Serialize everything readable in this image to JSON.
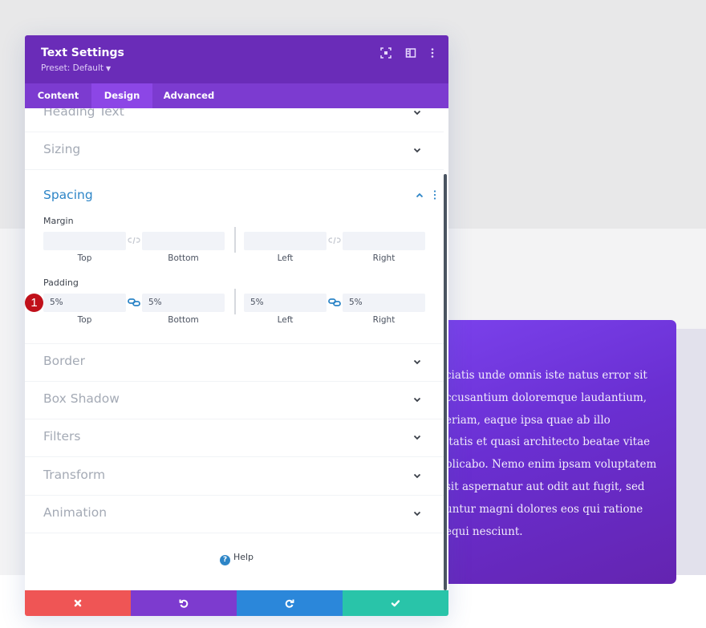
{
  "modal": {
    "title": "Text Settings",
    "preset_label": "Preset: Default",
    "header_icons": [
      "focus-icon",
      "split-view-icon",
      "more-options-icon"
    ],
    "tabs": [
      {
        "label": "Content",
        "active": false
      },
      {
        "label": "Design",
        "active": true
      },
      {
        "label": "Advanced",
        "active": false
      }
    ],
    "sections_above": [
      {
        "label": "Heading Text"
      },
      {
        "label": "Sizing"
      }
    ],
    "spacing": {
      "title": "Spacing",
      "margin": {
        "label": "Margin",
        "top": {
          "value": "",
          "label": "Top"
        },
        "bottom": {
          "value": "",
          "label": "Bottom"
        },
        "left": {
          "value": "",
          "label": "Left"
        },
        "right": {
          "value": "",
          "label": "Right"
        },
        "linked": false
      },
      "padding": {
        "label": "Padding",
        "top": {
          "value": "5%",
          "label": "Top"
        },
        "bottom": {
          "value": "5%",
          "label": "Bottom"
        },
        "left": {
          "value": "5%",
          "label": "Left"
        },
        "right": {
          "value": "5%",
          "label": "Right"
        },
        "linked": true
      }
    },
    "sections_below": [
      {
        "label": "Border"
      },
      {
        "label": "Box Shadow"
      },
      {
        "label": "Filters"
      },
      {
        "label": "Transform"
      },
      {
        "label": "Animation"
      }
    ],
    "help_label": "Help",
    "footer": {
      "cancel": "close-icon",
      "undo": "undo-icon",
      "redo": "redo-icon",
      "save": "check-icon"
    }
  },
  "annotation_badge": "1",
  "preview_card": {
    "lines": [
      "ciatis unde omnis iste natus error sit",
      "ccusantium doloremque laudantium,",
      "eriam, eaque ipsa quae ab illo",
      "itatis et quasi architecto beatae vitae",
      "plicabo. Nemo enim ipsam voluptatem",
      " sit aspernatur aut odit aut fugit, sed",
      "untur magni dolores eos qui ratione",
      "equi nesciunt."
    ]
  },
  "colors": {
    "header_purple": "#6a2cb8",
    "tabs_purple": "#7c3bd0",
    "active_tab": "#8c46e6",
    "accent_blue": "#2d85c7",
    "cancel_red": "#ef5555",
    "undo_purple": "#7d3bcf",
    "redo_blue": "#2b87da",
    "save_green": "#29c4a9",
    "badge_red": "#c0101a"
  }
}
